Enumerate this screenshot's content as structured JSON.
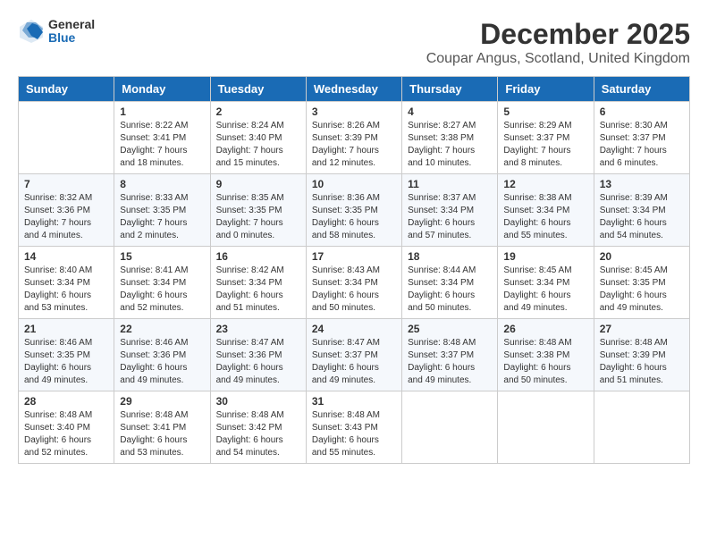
{
  "logo": {
    "general": "General",
    "blue": "Blue"
  },
  "header": {
    "month": "December 2025",
    "location": "Coupar Angus, Scotland, United Kingdom"
  },
  "weekdays": [
    "Sunday",
    "Monday",
    "Tuesday",
    "Wednesday",
    "Thursday",
    "Friday",
    "Saturday"
  ],
  "weeks": [
    [
      {
        "day": "",
        "info": ""
      },
      {
        "day": "1",
        "info": "Sunrise: 8:22 AM\nSunset: 3:41 PM\nDaylight: 7 hours\nand 18 minutes."
      },
      {
        "day": "2",
        "info": "Sunrise: 8:24 AM\nSunset: 3:40 PM\nDaylight: 7 hours\nand 15 minutes."
      },
      {
        "day": "3",
        "info": "Sunrise: 8:26 AM\nSunset: 3:39 PM\nDaylight: 7 hours\nand 12 minutes."
      },
      {
        "day": "4",
        "info": "Sunrise: 8:27 AM\nSunset: 3:38 PM\nDaylight: 7 hours\nand 10 minutes."
      },
      {
        "day": "5",
        "info": "Sunrise: 8:29 AM\nSunset: 3:37 PM\nDaylight: 7 hours\nand 8 minutes."
      },
      {
        "day": "6",
        "info": "Sunrise: 8:30 AM\nSunset: 3:37 PM\nDaylight: 7 hours\nand 6 minutes."
      }
    ],
    [
      {
        "day": "7",
        "info": "Sunrise: 8:32 AM\nSunset: 3:36 PM\nDaylight: 7 hours\nand 4 minutes."
      },
      {
        "day": "8",
        "info": "Sunrise: 8:33 AM\nSunset: 3:35 PM\nDaylight: 7 hours\nand 2 minutes."
      },
      {
        "day": "9",
        "info": "Sunrise: 8:35 AM\nSunset: 3:35 PM\nDaylight: 7 hours\nand 0 minutes."
      },
      {
        "day": "10",
        "info": "Sunrise: 8:36 AM\nSunset: 3:35 PM\nDaylight: 6 hours\nand 58 minutes."
      },
      {
        "day": "11",
        "info": "Sunrise: 8:37 AM\nSunset: 3:34 PM\nDaylight: 6 hours\nand 57 minutes."
      },
      {
        "day": "12",
        "info": "Sunrise: 8:38 AM\nSunset: 3:34 PM\nDaylight: 6 hours\nand 55 minutes."
      },
      {
        "day": "13",
        "info": "Sunrise: 8:39 AM\nSunset: 3:34 PM\nDaylight: 6 hours\nand 54 minutes."
      }
    ],
    [
      {
        "day": "14",
        "info": "Sunrise: 8:40 AM\nSunset: 3:34 PM\nDaylight: 6 hours\nand 53 minutes."
      },
      {
        "day": "15",
        "info": "Sunrise: 8:41 AM\nSunset: 3:34 PM\nDaylight: 6 hours\nand 52 minutes."
      },
      {
        "day": "16",
        "info": "Sunrise: 8:42 AM\nSunset: 3:34 PM\nDaylight: 6 hours\nand 51 minutes."
      },
      {
        "day": "17",
        "info": "Sunrise: 8:43 AM\nSunset: 3:34 PM\nDaylight: 6 hours\nand 50 minutes."
      },
      {
        "day": "18",
        "info": "Sunrise: 8:44 AM\nSunset: 3:34 PM\nDaylight: 6 hours\nand 50 minutes."
      },
      {
        "day": "19",
        "info": "Sunrise: 8:45 AM\nSunset: 3:34 PM\nDaylight: 6 hours\nand 49 minutes."
      },
      {
        "day": "20",
        "info": "Sunrise: 8:45 AM\nSunset: 3:35 PM\nDaylight: 6 hours\nand 49 minutes."
      }
    ],
    [
      {
        "day": "21",
        "info": "Sunrise: 8:46 AM\nSunset: 3:35 PM\nDaylight: 6 hours\nand 49 minutes."
      },
      {
        "day": "22",
        "info": "Sunrise: 8:46 AM\nSunset: 3:36 PM\nDaylight: 6 hours\nand 49 minutes."
      },
      {
        "day": "23",
        "info": "Sunrise: 8:47 AM\nSunset: 3:36 PM\nDaylight: 6 hours\nand 49 minutes."
      },
      {
        "day": "24",
        "info": "Sunrise: 8:47 AM\nSunset: 3:37 PM\nDaylight: 6 hours\nand 49 minutes."
      },
      {
        "day": "25",
        "info": "Sunrise: 8:48 AM\nSunset: 3:37 PM\nDaylight: 6 hours\nand 49 minutes."
      },
      {
        "day": "26",
        "info": "Sunrise: 8:48 AM\nSunset: 3:38 PM\nDaylight: 6 hours\nand 50 minutes."
      },
      {
        "day": "27",
        "info": "Sunrise: 8:48 AM\nSunset: 3:39 PM\nDaylight: 6 hours\nand 51 minutes."
      }
    ],
    [
      {
        "day": "28",
        "info": "Sunrise: 8:48 AM\nSunset: 3:40 PM\nDaylight: 6 hours\nand 52 minutes."
      },
      {
        "day": "29",
        "info": "Sunrise: 8:48 AM\nSunset: 3:41 PM\nDaylight: 6 hours\nand 53 minutes."
      },
      {
        "day": "30",
        "info": "Sunrise: 8:48 AM\nSunset: 3:42 PM\nDaylight: 6 hours\nand 54 minutes."
      },
      {
        "day": "31",
        "info": "Sunrise: 8:48 AM\nSunset: 3:43 PM\nDaylight: 6 hours\nand 55 minutes."
      },
      {
        "day": "",
        "info": ""
      },
      {
        "day": "",
        "info": ""
      },
      {
        "day": "",
        "info": ""
      }
    ]
  ]
}
